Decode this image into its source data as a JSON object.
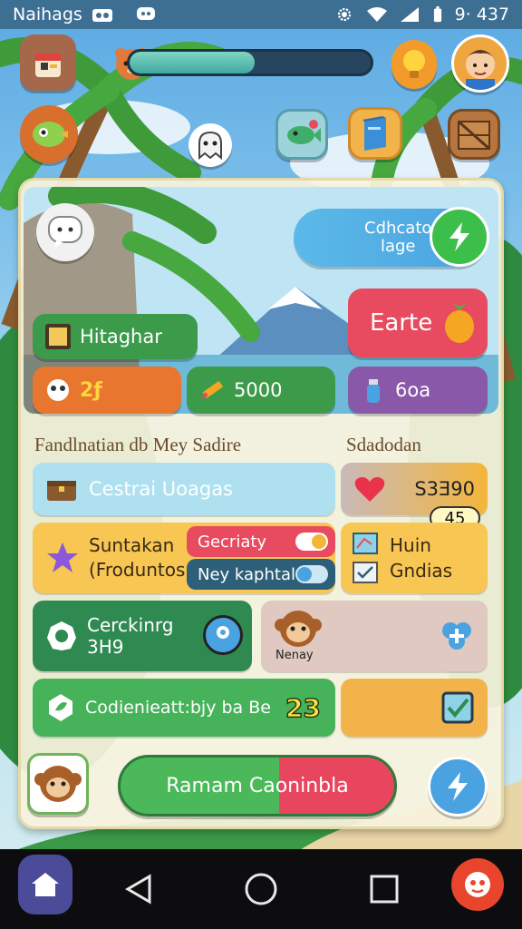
{
  "status_bar": {
    "app_name": "Naihags",
    "time": "9· 437",
    "icons": [
      "camera-icon",
      "chat-bubble-icon",
      "settings-gear-icon",
      "wifi-icon",
      "signal-icon",
      "battery-icon"
    ]
  },
  "hud": {
    "left_top_icon": "shop-bag-icon",
    "left_mid_icon": "bird-icon",
    "ghost_icon": "ghost-icon",
    "pet_icon": "pet-face-icon",
    "progress_fraction": 0.52,
    "map_icon": "fish-map-icon",
    "book_icon": "book-icon",
    "crate_icon": "crate-icon",
    "hint_icon": "lightbulb-icon",
    "player_avatar": "player-avatar"
  },
  "panel": {
    "action_top": {
      "line1": "Cdhcato",
      "line2": "lage",
      "icon": "lightning-icon"
    },
    "earth_button": "Earte",
    "earth_icon": "fruit-icon",
    "village_label": "Hitaghar",
    "stats": [
      {
        "icon": "puzzle-icon",
        "value": "2ƒ",
        "color": "#e8762f"
      },
      {
        "icon": "pencil-icon",
        "value": "5000",
        "color": "#3c9a4b"
      },
      {
        "icon": "potion-icon",
        "value": "6oa",
        "color": "#8a58a8"
      }
    ],
    "section_left_title": "Fandlnatian db Mey Sadire",
    "section_right_title": "Sdadodan",
    "rows": {
      "central": {
        "label": "Cestrai Uoagas",
        "icon": "chest-icon"
      },
      "heart": {
        "value": "S3Ǝ90",
        "icon": "heart-icon"
      },
      "badge": "45",
      "suntakan": {
        "line1": "Suntakan",
        "line2": "(Froduntos",
        "icon": "star-shape-icon"
      },
      "toggle_a": {
        "label": "Gecriaty",
        "on": true
      },
      "toggle_b": {
        "label": "Ney kaphtal",
        "on": false
      },
      "hunt": {
        "line1": "Huin",
        "line2": "Gndias",
        "icon_a": "map-scroll-icon",
        "icon_b": "list-check-icon"
      },
      "cooking": {
        "line1": "Cerckinrg",
        "line2": "3H9",
        "icon": "badge-icon",
        "pin_icon": "location-pin-icon"
      },
      "nenay": {
        "label": "Nenay",
        "icon": "monkey-avatar",
        "action_icon": "add-icon"
      },
      "bottom": {
        "label": "Codienieatt:bjy ba Be",
        "number": "23",
        "icon": "leaf-icon",
        "check_icon": "checkbox-icon"
      }
    },
    "main_button": "Ramam Caoninbla",
    "monkey_icon": "monkey-avatar",
    "boost_icon": "lightning-icon"
  },
  "nav": {
    "home_icon": "home-icon",
    "back_icon": "back-triangle-icon",
    "home_circle_icon": "home-circle-icon",
    "recents_icon": "recents-square-icon",
    "game_icon": "game-app-icon"
  },
  "colors": {
    "accent_blue": "#4aa3e0",
    "accent_green": "#46b35a",
    "accent_red": "#e84b5f",
    "accent_orange": "#f4b63a",
    "panel_bg": "#f8f3de"
  }
}
